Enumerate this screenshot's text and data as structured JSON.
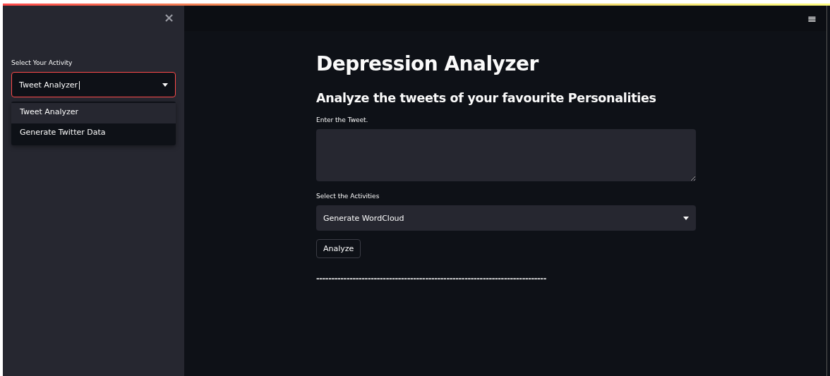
{
  "sidebar": {
    "close_icon": "×",
    "select": {
      "label": "Select Your Activity",
      "value": "Tweet Analyzer",
      "focused": true,
      "options": [
        {
          "label": "Tweet Analyzer",
          "selected": true
        },
        {
          "label": "Generate Twitter Data",
          "selected": false
        }
      ]
    }
  },
  "menu_icon": "≡",
  "main": {
    "title": "Depression Analyzer",
    "subtitle": "Analyze the tweets of your favourite Personalities",
    "tweet_field": {
      "label": "Enter the Tweet."
    },
    "activities_select": {
      "label": "Select the Activities",
      "value": "Generate WordCloud"
    },
    "analyze_button": "Analyze",
    "divider_text": "----------------------------------------------------------------------------"
  }
}
